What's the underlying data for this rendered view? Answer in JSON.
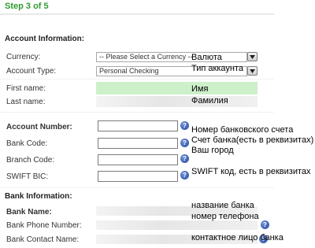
{
  "step_title": "Step 3 of 5",
  "sections": {
    "account_information": "Account Information:",
    "bank_information": "Bank Information:"
  },
  "fields": {
    "currency": {
      "label": "Currency:",
      "value": "-- Please Select a Currency --",
      "note": "Валюта"
    },
    "account_type": {
      "label": "Account Type:",
      "value": "Personal Checking",
      "note": "Тип аккаунта"
    },
    "first_name": {
      "label": "First name:",
      "note": "Имя"
    },
    "last_name": {
      "label": "Last name:",
      "note": "Фамилия"
    },
    "account_number": {
      "label": "Account Number:",
      "note": "Номер банковского счета"
    },
    "bank_code": {
      "label": "Bank Code:",
      "note": "Счет банка(есть в реквизитах)"
    },
    "branch_code": {
      "label": "Branch Code:",
      "note": "Ваш город"
    },
    "swift_bic": {
      "label": "SWIFT BIC:",
      "note": "SWIFT код, есть в реквизитах"
    },
    "bank_name": {
      "label": "Bank Name:",
      "note": "название банка"
    },
    "bank_phone": {
      "label": "Bank Phone Number:",
      "note": "номер телефона"
    },
    "bank_contact": {
      "label": "Bank Contact Name:",
      "note": "контактное лицо банка"
    }
  },
  "help_glyph": "?",
  "colors": {
    "step_title": "#2f9a2f",
    "name_highlight": "#cdf0cb",
    "help_icon": "#23469d"
  }
}
